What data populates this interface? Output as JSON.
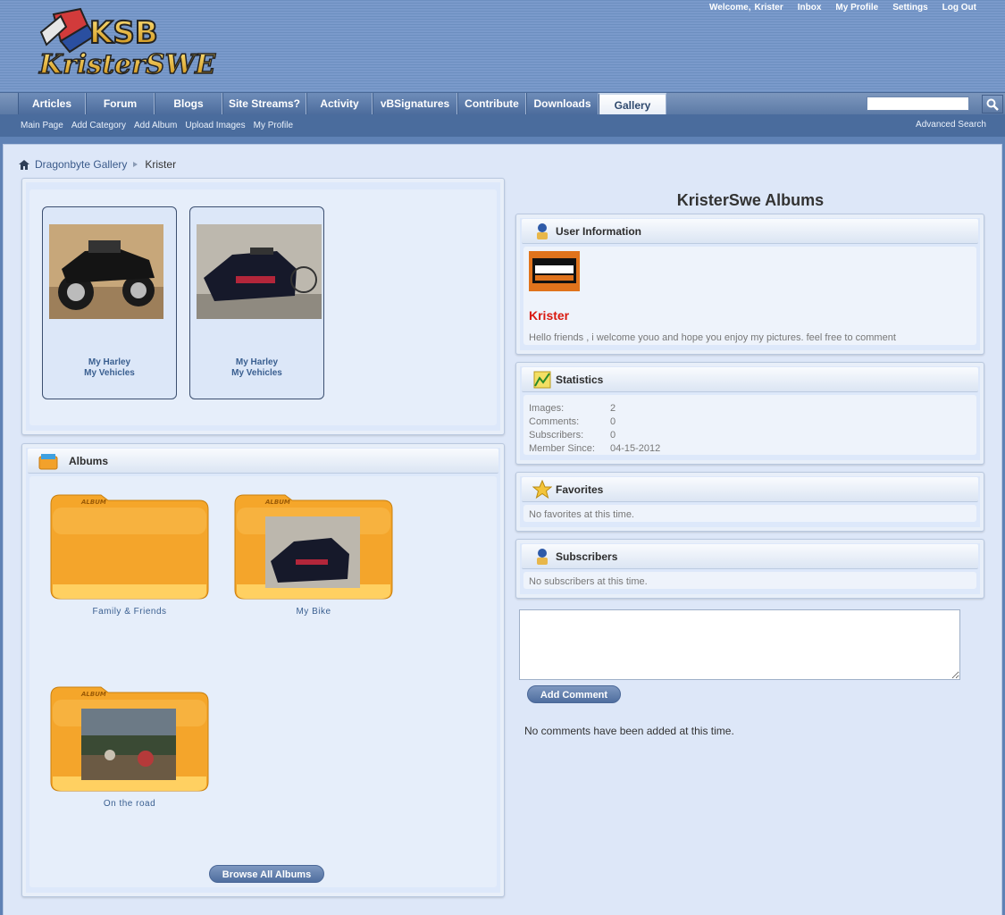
{
  "header": {
    "logo_text": "KristerSWE",
    "welcome": "Welcome,",
    "username": "Krister",
    "links": [
      "Inbox",
      "My Profile",
      "Settings",
      "Log Out"
    ]
  },
  "nav": {
    "tabs": [
      {
        "label": "Articles"
      },
      {
        "label": "Forum"
      },
      {
        "label": "Blogs"
      },
      {
        "label": "Site Streams?"
      },
      {
        "label": "Activity"
      },
      {
        "label": "vBSignatures"
      },
      {
        "label": "Contribute"
      },
      {
        "label": "Downloads"
      },
      {
        "label": "Gallery",
        "active": true
      }
    ],
    "sublinks": [
      "Main Page",
      "Add Category",
      "Add Album",
      "Upload Images",
      "My Profile"
    ],
    "advanced_search": "Advanced Search"
  },
  "breadcrumb": {
    "root": "Dragonbyte Gallery",
    "current": "Krister"
  },
  "recent_images": [
    {
      "title": "My Harley",
      "album": "My Vehicles"
    },
    {
      "title": "My Harley",
      "album": "My Vehicles"
    }
  ],
  "albums": {
    "title": "Albums",
    "folder_tag": "ALBUM",
    "items": [
      {
        "name": "Family & Friends"
      },
      {
        "name": "My Bike"
      },
      {
        "name": "On the road"
      }
    ],
    "browse_button": "Browse All Albums"
  },
  "profile": {
    "heading": "KristerSwe Albums",
    "user_info_title": "User Information",
    "name": "Krister",
    "bio": "Hello friends , i welcome youo and hope you enjoy my pictures. feel free to comment",
    "statistics_title": "Statistics",
    "stats": [
      {
        "label": "Images:",
        "value": "2"
      },
      {
        "label": "Comments:",
        "value": "0"
      },
      {
        "label": "Subscribers:",
        "value": "0"
      },
      {
        "label": "Member Since:",
        "value": "04-15-2012"
      }
    ],
    "favorites_title": "Favorites",
    "favorites_text": "No favorites at this time.",
    "subscribers_title": "Subscribers",
    "subscribers_text": "No subscribers at this time.",
    "add_comment": "Add Comment",
    "no_comments": "No comments have been added at this time."
  },
  "colors": {
    "accent": "#4a6c9d",
    "username_red": "#d9190f",
    "folder_orange": "#f39c1d"
  }
}
